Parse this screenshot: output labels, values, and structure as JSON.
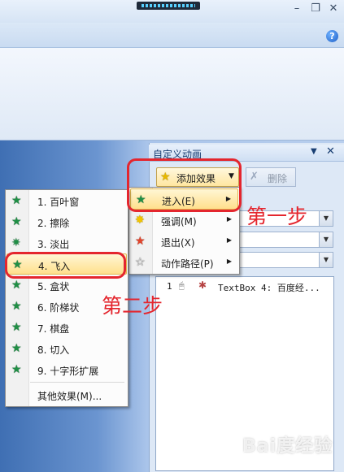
{
  "pane": {
    "title": "自定义动画",
    "dropdown_glyph": "▼",
    "close_glyph": "✕",
    "add_effect_label": "添加效果",
    "delete_label": "删除"
  },
  "submenu": {
    "items": [
      {
        "label": "进入(E)",
        "icon": "star-green-icon"
      },
      {
        "label": "强调(M)",
        "icon": "star-yellow-icon"
      },
      {
        "label": "退出(X)",
        "icon": "star-red-icon"
      },
      {
        "label": "动作路径(P)",
        "icon": "star-outline-icon"
      }
    ]
  },
  "effect_menu": {
    "items": [
      {
        "label": "1. 百叶窗"
      },
      {
        "label": "2. 擦除"
      },
      {
        "label": "3. 淡出"
      },
      {
        "label": "4. 飞入"
      },
      {
        "label": "5. 盒状"
      },
      {
        "label": "6. 阶梯状"
      },
      {
        "label": "7. 棋盘"
      },
      {
        "label": "8. 切入"
      },
      {
        "label": "9. 十字形扩展"
      }
    ],
    "more_label": "其他效果(M)..."
  },
  "animation_list": {
    "items": [
      {
        "index": "1",
        "text": "TextBox 4: 百度经..."
      }
    ]
  },
  "annotations": {
    "step1": "第一步",
    "step2": "第二步"
  },
  "watermark": "Bai度经验",
  "colors": {
    "annotation_red": "#e4262e",
    "highlight": "#ffe08d",
    "entrance_green": "#1f8f45"
  }
}
